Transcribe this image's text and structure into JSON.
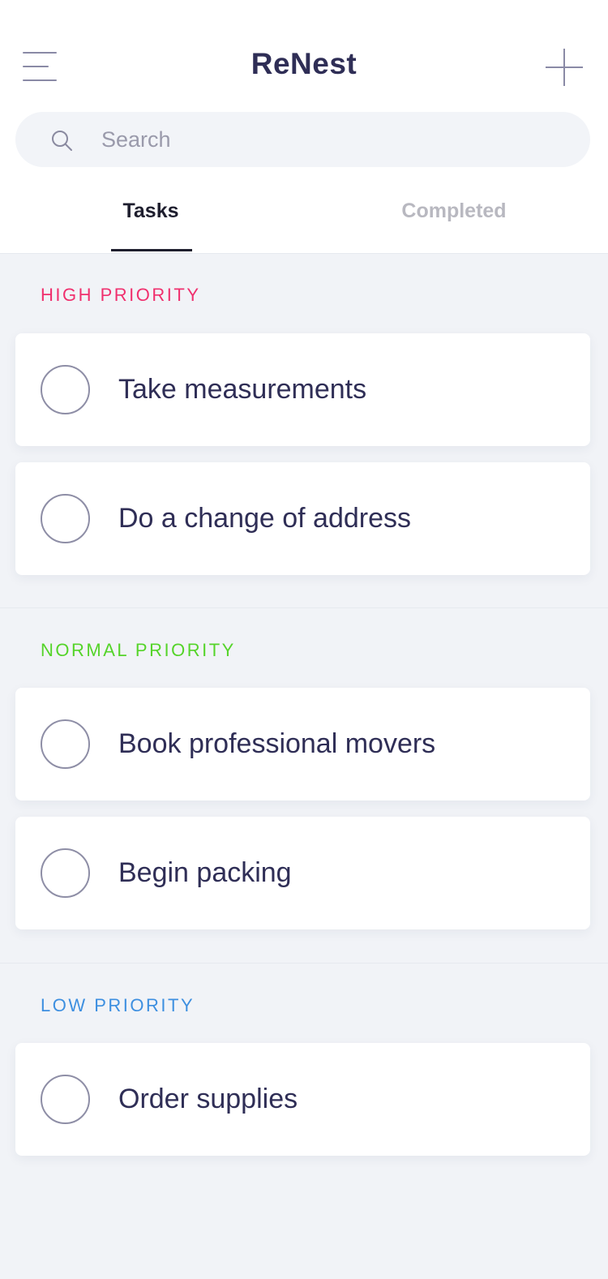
{
  "app": {
    "title": "ReNest"
  },
  "search": {
    "placeholder": "Search"
  },
  "tabs": [
    {
      "label": "Tasks",
      "active": true
    },
    {
      "label": "Completed",
      "active": false
    }
  ],
  "sections": [
    {
      "label": "HIGH PRIORITY",
      "color": "#f0306e",
      "tasks": [
        {
          "text": "Take measurements",
          "done": false
        },
        {
          "text": "Do a change of address",
          "done": false
        }
      ]
    },
    {
      "label": "NORMAL PRIORITY",
      "color": "#55d42a",
      "tasks": [
        {
          "text": "Book professional movers",
          "done": false
        },
        {
          "text": "Begin packing",
          "done": false
        }
      ]
    },
    {
      "label": "LOW PRIORITY",
      "color": "#3d8fe0",
      "tasks": [
        {
          "text": "Order supplies",
          "done": false
        }
      ]
    }
  ],
  "icons": {
    "menu": "hamburger-menu-icon",
    "add": "plus-icon",
    "search": "search-icon",
    "checkbox": "circle-checkbox-icon"
  }
}
